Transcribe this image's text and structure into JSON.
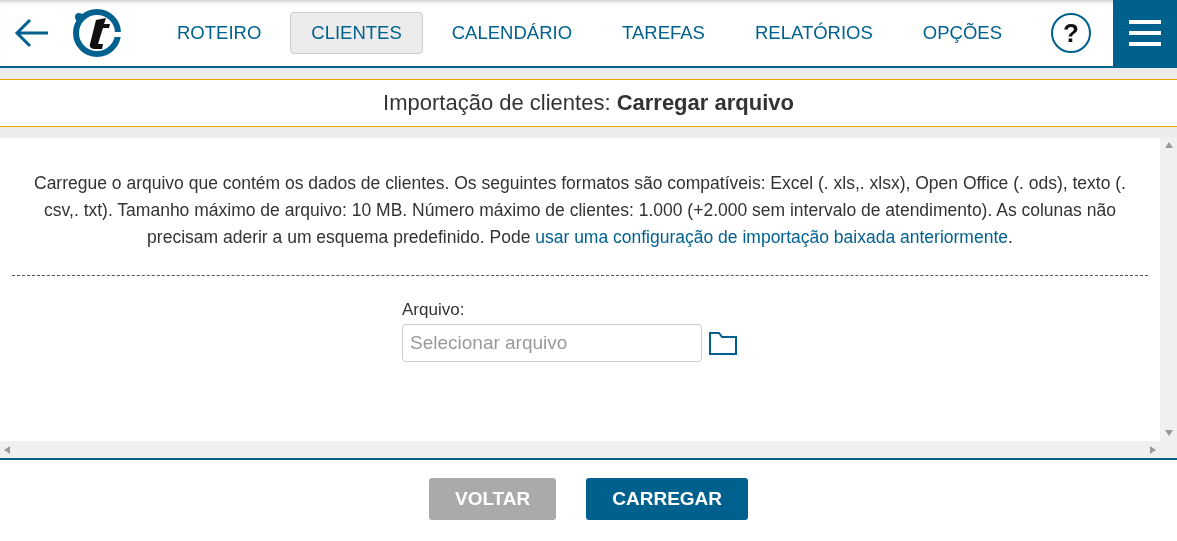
{
  "nav": {
    "tabs": [
      {
        "label": "ROTEIRO",
        "selected": false
      },
      {
        "label": "CLIENTES",
        "selected": true
      },
      {
        "label": "CALENDÁRIO",
        "selected": false
      },
      {
        "label": "TAREFAS",
        "selected": false
      },
      {
        "label": "RELATÓRIOS",
        "selected": false
      },
      {
        "label": "OPÇÕES",
        "selected": false
      }
    ],
    "help": "?"
  },
  "title": "Importação de clientes: **Carregar arquivo**",
  "description": {
    "text": "Carregue o arquivo que contém os dados de clientes. Os seguintes formatos são compatíveis: Excel (. xls,. xlsx), Open Office (. ods), texto (. csv,. txt). Tamanho máximo de arquivo: 10 MB. Número máximo de clientes: 1.000 (+2.000 sem intervalo de atendimento). As colunas não precisam aderir a um esquema predefinido. Pode ",
    "link": "usar uma configuração de importação baixada anteriormente",
    "after": "."
  },
  "file_field": {
    "label": "Arquivo:",
    "placeholder": "Selecionar arquivo"
  },
  "buttons": [
    {
      "label": "VOLTAR",
      "disabled": true
    },
    {
      "label": "CARREGAR",
      "disabled": false
    }
  ]
}
